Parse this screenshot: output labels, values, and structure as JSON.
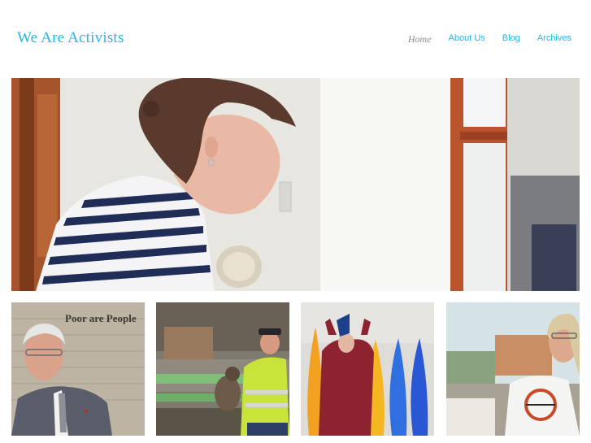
{
  "site": {
    "title": "We Are Activists"
  },
  "nav": {
    "items": [
      {
        "label": "Home",
        "current": true
      },
      {
        "label": "About Us",
        "current": false
      },
      {
        "label": "Blog",
        "current": false
      },
      {
        "label": "Archives",
        "current": false
      }
    ]
  },
  "hero": {
    "subject": "woman in striped shirt by window"
  },
  "thumbnails": [
    {
      "subject": "older man in suit and glasses",
      "wall_text": "Poor are People"
    },
    {
      "subject": "man in hi-vis jacket with cat on bench"
    },
    {
      "subject": "person with colorful kayaks"
    },
    {
      "subject": "woman with glasses by window"
    }
  ],
  "colors": {
    "accent": "#27b6e3",
    "nav_current": "#8a8a8a",
    "background": "#ffffff"
  }
}
